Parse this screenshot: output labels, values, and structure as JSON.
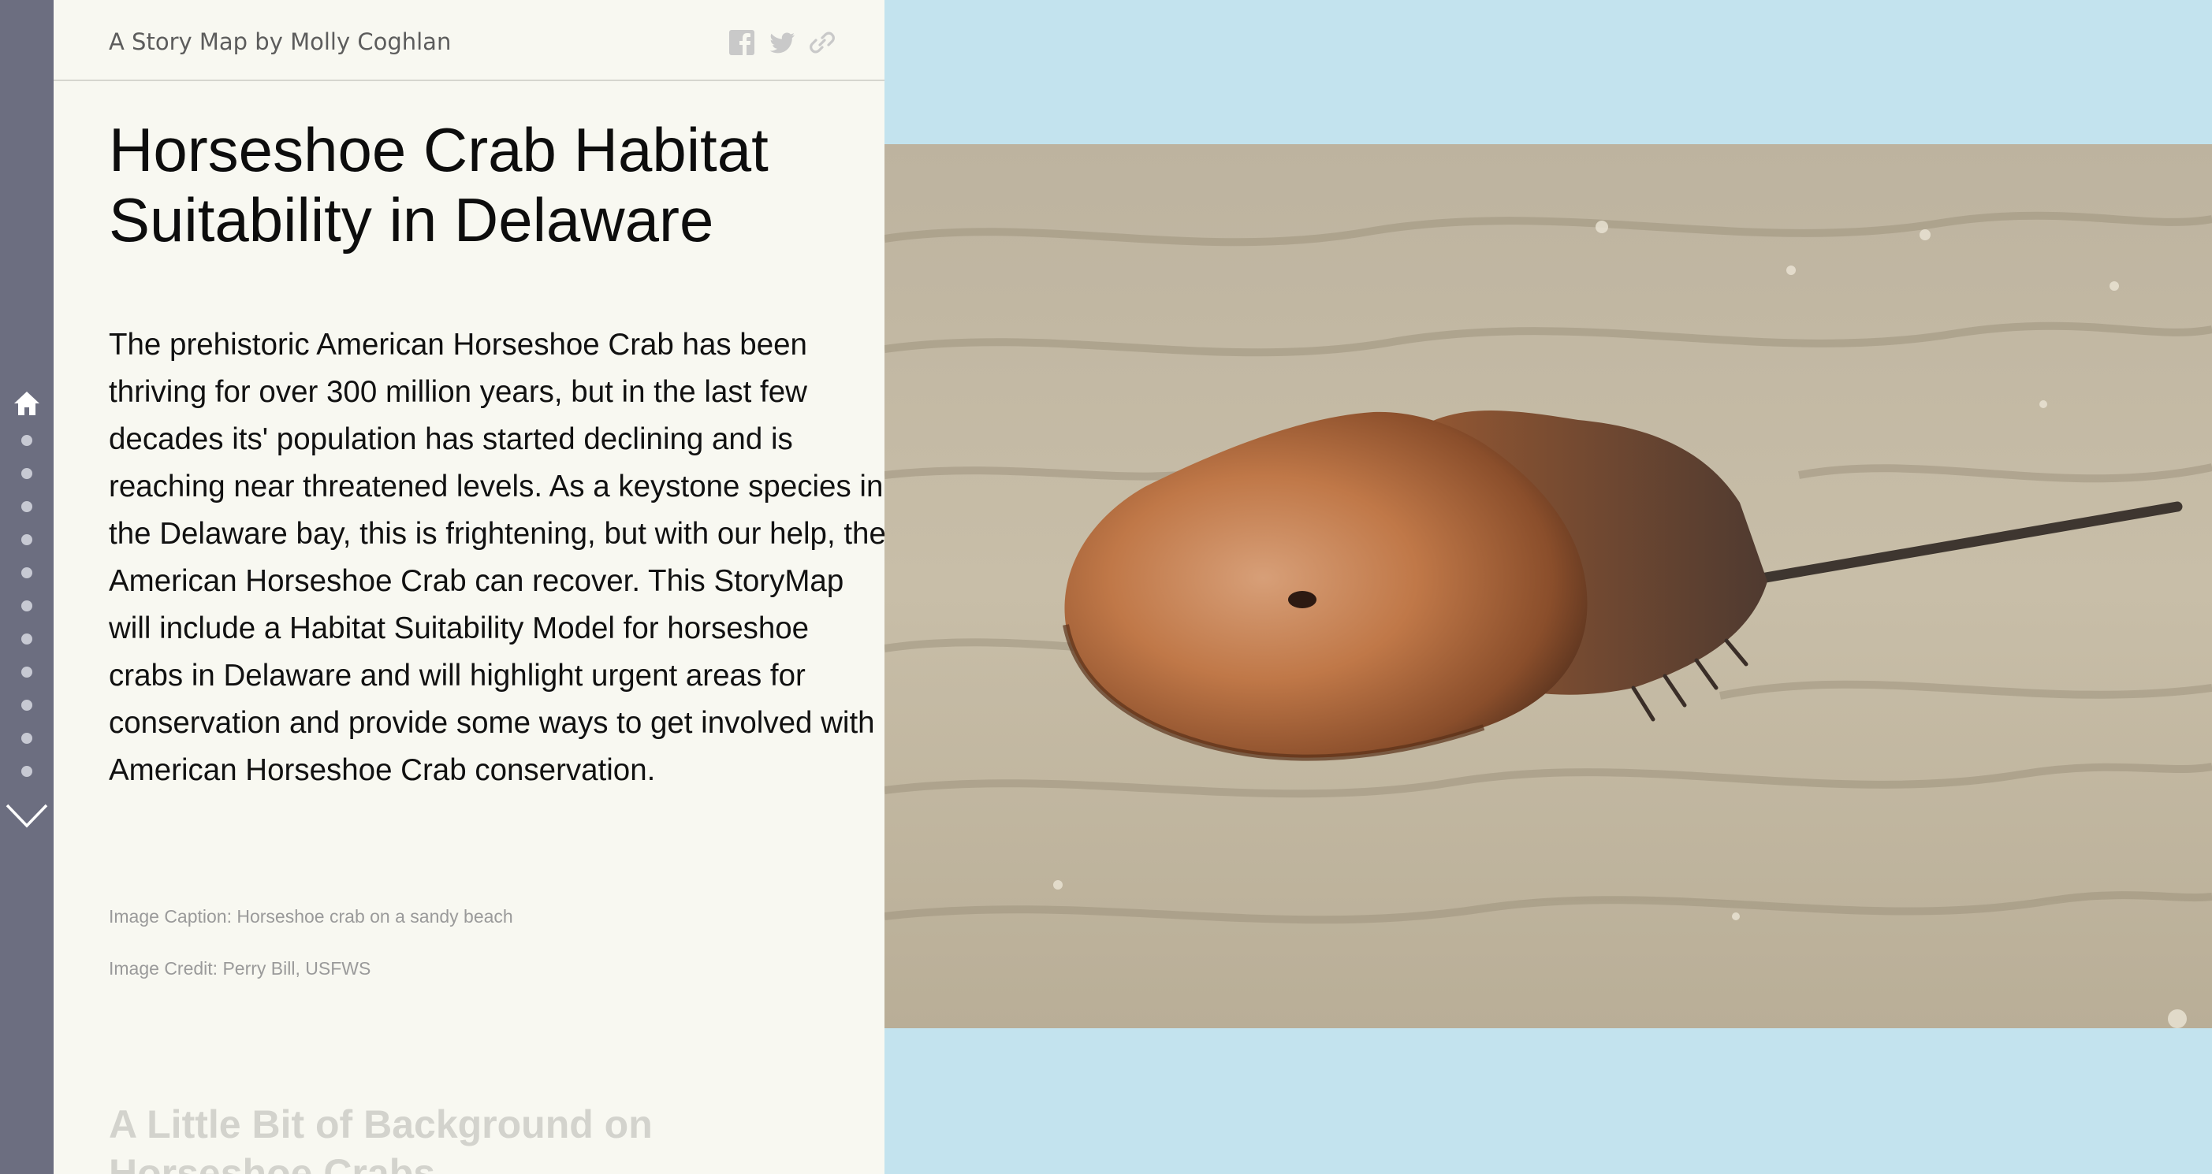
{
  "header": {
    "byline": "A Story Map by Molly Coghlan",
    "share_icons": [
      "facebook-icon",
      "twitter-icon",
      "link-icon"
    ]
  },
  "nav": {
    "home_icon": "home-icon",
    "section_dots": 11,
    "next_icon": "chevron-down-icon"
  },
  "story": {
    "title": "Horseshoe Crab Habitat Suitability in Delaware",
    "body": "The prehistoric American Horseshoe Crab has been thriving for over 300 million years, but in the last few decades its' population has started declining and is reaching near threatened levels. As a keystone species in the Delaware bay, this is frightening, but with our help, the American Horseshoe Crab can recover. This StoryMap will include a Habitat Suitability Model for horseshoe crabs in Delaware and will highlight urgent areas for conservation and provide some ways to get involved with American Horseshoe Crab conservation.",
    "caption": "Image Caption: Horseshoe crab on a sandy beach",
    "credit": "Image Credit: Perry Bill, USFWS",
    "next_section_title": "A Little Bit of Background on Horseshoe Crabs"
  },
  "colors": {
    "rail": "#6c6e80",
    "panel": "#f8f8f1",
    "stage": "#c3e3ee"
  }
}
